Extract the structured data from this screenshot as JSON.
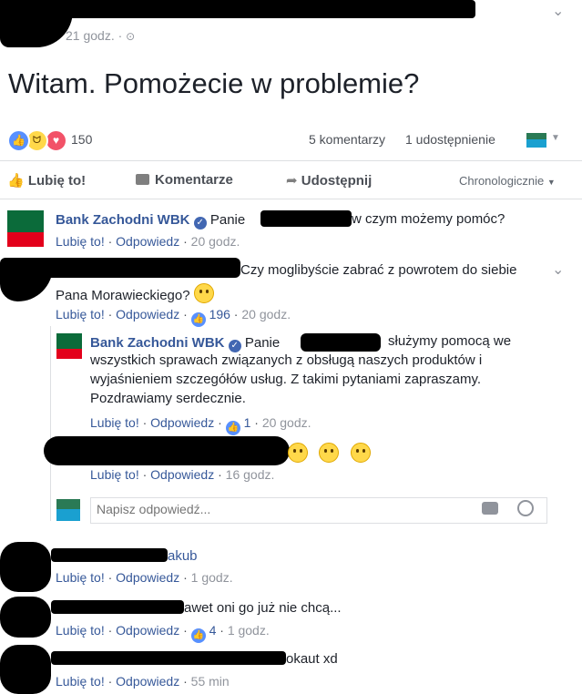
{
  "post": {
    "timestamp": "21 godz. · ",
    "text": "Witam. Pomożecie w problemie?",
    "reactions_count": "150",
    "comments_count": "5 komentarzy",
    "shares_count": "1 udostępnienie"
  },
  "actions": {
    "like": "Lubię to!",
    "comment": "Komentarze",
    "share": "Udostępnij",
    "sort": "Chronologicznie"
  },
  "labels": {
    "like": "Lubię to!",
    "reply": "Odpowiedz",
    "sep": " · "
  },
  "comments": [
    {
      "author": "Bank Zachodni WBK",
      "text_a": "Panie",
      "text_b": "w czym możemy pomóc?",
      "time": "20 godz."
    },
    {
      "text_a": "Czy moglibyście zabrać z powrotem do siebie",
      "text_b": "Pana Morawieckiego?",
      "likes": "196",
      "time": "20 godz."
    },
    {
      "author": "Bank Zachodni WBK",
      "text_a": "Panie",
      "text_b": "służymy pomocą we",
      "text_c": "wszystkich sprawach związanych z obsługą naszych produktów i",
      "text_d": "wyjaśnieniem szczegółów usług. Z takimi pytaniami zapraszamy.",
      "text_e": "Pozdrawiamy serdecznie.",
      "likes": "1",
      "time": "20 godz."
    },
    {
      "time": "16 godz."
    },
    {
      "text": "akub",
      "time": "1 godz."
    },
    {
      "text": "awet oni go już nie chcą...",
      "likes": "4",
      "time": "1 godz."
    },
    {
      "text": "okaut xd",
      "time": "55 min"
    }
  ],
  "reply_input": {
    "placeholder": "Napisz odpowiedź..."
  },
  "colors": {
    "link": "#365899",
    "like_blue": "#5890ff",
    "bank_green": "#0b6b3a",
    "bank_red": "#e3001b"
  }
}
